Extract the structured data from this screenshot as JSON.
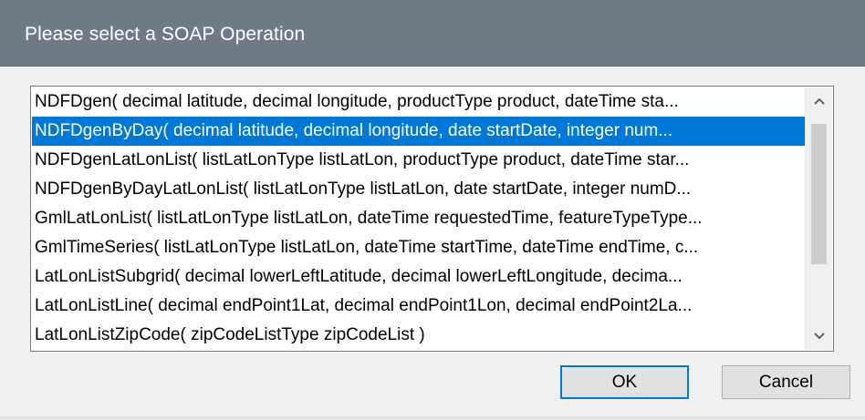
{
  "dialog": {
    "title": "Please select a SOAP Operation"
  },
  "operations": [
    "NDFDgen( decimal latitude, decimal longitude, productType product, dateTime sta...",
    "NDFDgenByDay( decimal latitude, decimal longitude, date startDate, integer num...",
    "NDFDgenLatLonList( listLatLonType listLatLon, productType product, dateTime star...",
    "NDFDgenByDayLatLonList( listLatLonType listLatLon, date startDate, integer numD...",
    "GmlLatLonList( listLatLonType listLatLon, dateTime requestedTime, featureTypeType...",
    "GmlTimeSeries( listLatLonType listLatLon, dateTime startTime, dateTime endTime, c...",
    "LatLonListSubgrid( decimal lowerLeftLatitude, decimal lowerLeftLongitude, decima...",
    "LatLonListLine( decimal endPoint1Lat, decimal endPoint1Lon, decimal endPoint2La...",
    "LatLonListZipCode( zipCodeListType zipCodeList )"
  ],
  "selected_index": 1,
  "buttons": {
    "ok_label": "OK",
    "cancel_label": "Cancel"
  },
  "icons": {
    "scroll_up": "chevron-up-icon",
    "scroll_down": "chevron-down-icon"
  },
  "colors": {
    "selection": "#0078d7",
    "titlebar": "#6f7a87"
  }
}
